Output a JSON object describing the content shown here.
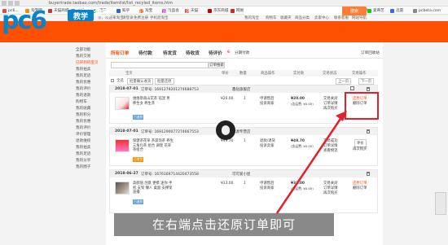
{
  "browser": {
    "url": "buyertrade.taobao.com/trade/itemlist/list_recyled_items.htm",
    "bookmarks": [
      "pc6...",
      "淘宝网",
      "天猫商城",
      "京东",
      "百度",
      "知乎",
      "淘宝",
      "唯品会",
      "天猫",
      "京东商城",
      "网易",
      "腾讯",
      "有道翻译",
      "迅雷看看",
      "360导航",
      "pc6下载站",
      "爱奇艺",
      "迅雷",
      "pcbeta.com"
    ]
  },
  "taobao_topbar": {
    "items": [
      "亲，欢迎来淘宝",
      "请登录",
      "免费注册",
      "手机逛淘宝",
      "我的淘宝",
      "购物车",
      "收藏夹",
      "商品分类",
      "卖家中心",
      "联系客服",
      "网站导航"
    ]
  },
  "logo": {
    "letters": "pc6",
    "badge": "教学"
  },
  "header": {
    "title": "我的淘宝",
    "nav": [
      "首页",
      "账户设置",
      "消息"
    ],
    "search_button": "搜索"
  },
  "sidebar": {
    "items": [
      "全部功能",
      "我的交易",
      "已买到的宝贝",
      "我的拍卖",
      "我的足迹",
      "我的优惠",
      "我的评价",
      "我的退款",
      "购物车",
      "我的收藏",
      "我的积分",
      "我的优惠",
      "我的评价",
      "评价管理",
      "退款维权",
      "我的拍卖",
      "我的足迹",
      "我的分享",
      "我的圈子"
    ],
    "highlight_index": 2
  },
  "tabs": {
    "items": [
      "所有订单",
      "待付款",
      "待发货",
      "待收货",
      "待评价"
    ],
    "active_index": 0,
    "badge": "6",
    "extra": "分期付款",
    "right_link": "订单回收站"
  },
  "search": {
    "placeholder": "",
    "button": "订单搜索"
  },
  "columns": [
    "宝贝",
    "单价",
    "数量",
    "商品操作",
    "实付款",
    "交易状态",
    "交易操作"
  ],
  "toolbar": {
    "left": "全选",
    "batch": "批量确认收货",
    "batch2": "批量还原",
    "prev": "上一页",
    "next": "下一页"
  },
  "orders": [
    {
      "date": "2018-07-01",
      "order_no": "订单号: 1691279201274688753",
      "shop": "鑫钻旗舰店",
      "title": "维维斯高山花茶 祛湿 男 养生女 养生茶",
      "price": "¥20.00",
      "qty": "1",
      "ops": [
        "申请售后",
        "投诉商家"
      ],
      "paid": "¥20.00",
      "paid_note": "(含运费: ¥0.00)",
      "status": [
        "交易关闭",
        "订单详情",
        "再次购买"
      ],
      "actions": [
        "还原订单",
        "删除订单"
      ],
      "tag": "已退款"
    },
    {
      "date": "2018-07-01",
      "order_no": "订单号: 1691290077274667553",
      "shop": "绿源专营店",
      "title": "保健茶花草 茶袋泡茶 养生 三角包茶 组合 调理 花草茶组合",
      "price": "¥49.70",
      "qty": "1",
      "ops": [
        "退款/退货",
        "投诉卖家"
      ],
      "paid": "¥49.70",
      "paid_note": "(含运费: ¥0.00)",
      "status": [
        "交易成功",
        "订单详情",
        "查看物流"
      ],
      "actions": [
        "评价",
        "再次购买"
      ],
      "tag": "已收货"
    },
    {
      "date": "2018-06-27",
      "order_no": "订单号: 1676169714420473558",
      "shop": "可可爱小屋",
      "title": "高颜值 创意 便携 迷你 手机 支架 懒人 桌面 支撑架 直播",
      "price": "¥33.00",
      "qty": "1",
      "ops": [
        "申请售后",
        "投诉商家"
      ],
      "paid": "¥33.00",
      "paid_note": "(含运费: ¥0.00)",
      "status": [
        "交易关闭",
        "订单详情",
        "再次购买"
      ],
      "actions": [
        "还原订单",
        "删除订单"
      ],
      "tag": "已退款"
    }
  ],
  "subtitle": "在右端点击还原订单即可",
  "colors": {
    "taobao_orange": "#ff5000",
    "logo_blue": "#0a83c9",
    "highlight_red": "#e4202d"
  }
}
